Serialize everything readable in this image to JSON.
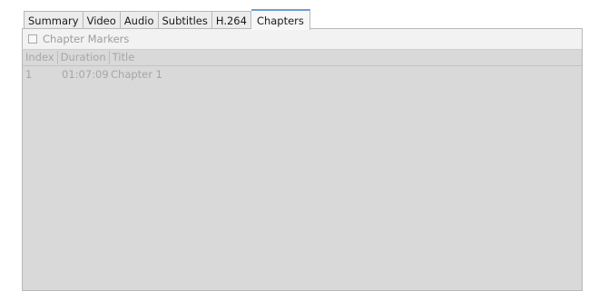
{
  "tabs": [
    {
      "label": "Summary",
      "active": false
    },
    {
      "label": "Video",
      "active": false
    },
    {
      "label": "Audio",
      "active": false
    },
    {
      "label": "Subtitles",
      "active": false
    },
    {
      "label": "H.264",
      "active": false
    },
    {
      "label": "Chapters",
      "active": true
    }
  ],
  "chapters_panel": {
    "markers_label": "Chapter Markers",
    "markers_checked": false,
    "columns": [
      "Index",
      "Duration",
      "Title"
    ],
    "rows": [
      {
        "index": "1",
        "duration": "01:07:09",
        "title": "Chapter 1"
      }
    ]
  },
  "colors": {
    "active_tab_accent": "#6f9fd0",
    "panel_background": "#d9d9d9",
    "disabled_text": "#a6a6a6"
  }
}
